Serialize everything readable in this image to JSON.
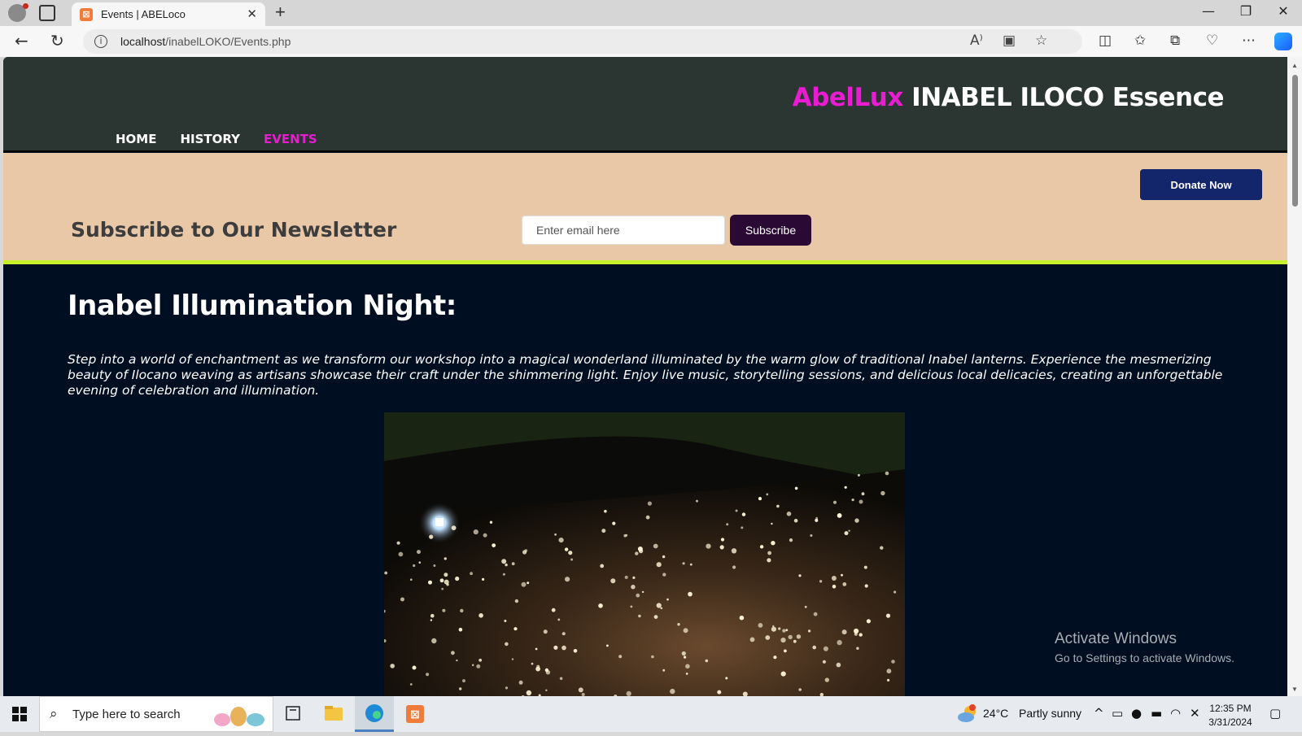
{
  "browser": {
    "tab_title": "Events | ABELoco",
    "tab_favicon": "xampp-favicon",
    "url_host": "localhost",
    "url_path": "/inabelLOKO/Events.php"
  },
  "site": {
    "brand_accent": "AbelLux",
    "brand_rest": " INABEL ILOCO Essence",
    "nav": [
      {
        "label": "HOME"
      },
      {
        "label": "HISTORY"
      },
      {
        "label": "EVENTS"
      }
    ],
    "donate_label": "Donate Now",
    "newsletter_title": "Subscribe to Our Newsletter",
    "email_placeholder": "Enter email here",
    "subscribe_label": "Subscribe",
    "colors": {
      "header_bg": "#2b3633",
      "accent_magenta": "#e81cd1",
      "newsletter_bg": "#e9c8a8",
      "lime_border": "#c8f02c",
      "page_bg": "#000e22",
      "donate_bg": "#13266b",
      "subscribe_bg": "#2a0a34"
    }
  },
  "event": {
    "title": "Inabel Illumination Night:",
    "description": "Step into a world of enchantment as we transform our workshop into a magical wonderland illuminated by the warm glow of traditional Inabel lanterns. Experience the mesmerizing beauty of Ilocano weaving as artisans showcase their craft under the shimmering light. Enjoy live music, storytelling sessions, and delicious local delicacies, creating an unforgettable evening of celebration and illumination."
  },
  "watermark": {
    "line1": "Activate Windows",
    "line2": "Go to Settings to activate Windows."
  },
  "taskbar": {
    "search_placeholder": "Type here to search",
    "weather_temp": "24°C",
    "weather_text": "Partly sunny",
    "time": "12:35 PM",
    "date": "3/31/2024"
  }
}
